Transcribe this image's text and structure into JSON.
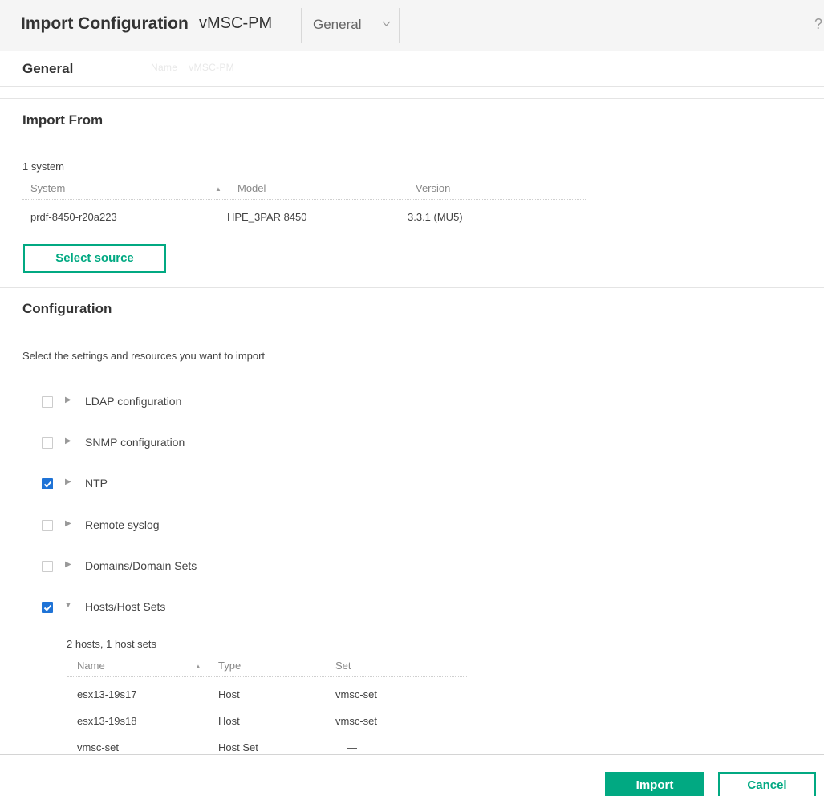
{
  "header": {
    "title": "Import Configuration",
    "resource": "vMSC-PM",
    "view_select": "General",
    "chevron": "⌄",
    "help_icon": "?"
  },
  "general": {
    "label": "General",
    "faded_name_label": "Name",
    "faded_name_value": "vMSC-PM"
  },
  "import_from": {
    "title": "Import From",
    "count": "1 system",
    "columns": [
      "System",
      "Model",
      "Version"
    ],
    "rows": [
      [
        "prdf-8450-r20a223",
        "HPE_3PAR 8450",
        "3.3.1 (MU5)"
      ]
    ],
    "select_source_label": "Select source"
  },
  "configuration": {
    "title": "Configuration",
    "description": "Select the settings and resources you want to import",
    "options": [
      {
        "label": "LDAP configuration",
        "checked": false,
        "expanded": false
      },
      {
        "label": "SNMP configuration",
        "checked": false,
        "expanded": false
      },
      {
        "label": "NTP",
        "checked": true,
        "expanded": false
      },
      {
        "label": "Remote syslog",
        "checked": false,
        "expanded": false
      },
      {
        "label": "Domains/Domain Sets",
        "checked": false,
        "expanded": false
      },
      {
        "label": "Hosts/Host Sets",
        "checked": true,
        "expanded": true
      }
    ],
    "hosts": {
      "count": "2 hosts, 1 host sets",
      "columns": [
        "Name",
        "Type",
        "Set"
      ],
      "rows": [
        [
          "esx13-19s17",
          "Host",
          "vmsc-set"
        ],
        [
          "esx13-19s18",
          "Host",
          "vmsc-set"
        ],
        [
          "vmsc-set",
          "Host Set",
          "—"
        ]
      ]
    }
  },
  "footer": {
    "import_label": "Import",
    "cancel_label": "Cancel"
  },
  "icons": {
    "sort_up": "▲",
    "triangle_right": "▶",
    "triangle_down": "▼"
  },
  "colors": {
    "accent": "#01a982",
    "checkbox": "#1f73d6"
  }
}
